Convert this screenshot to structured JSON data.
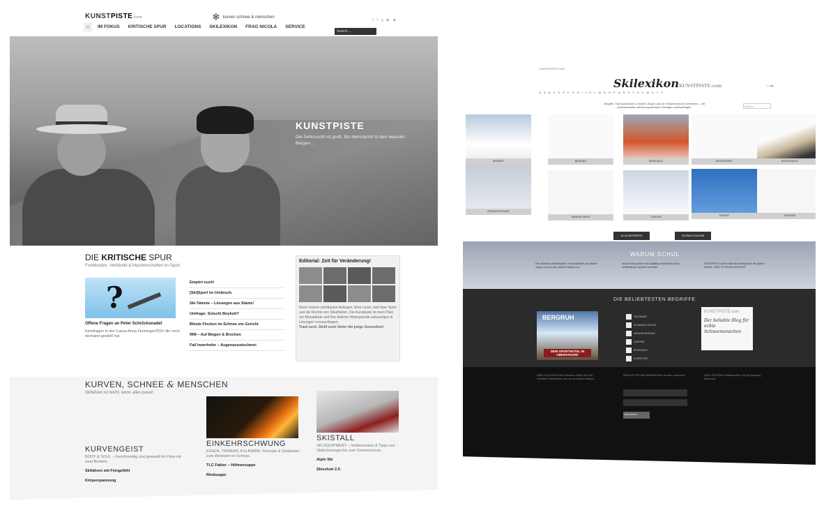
{
  "left": {
    "logo": {
      "main": "KUNST",
      "bold": "PISTE",
      "suffix": ".com"
    },
    "center_logo": "kurven schnee & menschen",
    "nav": [
      {
        "label": "⌂"
      },
      {
        "label": "IM FOKUS"
      },
      {
        "label": "KRITISCHE SPUR"
      },
      {
        "label": "LOCATIONS"
      },
      {
        "label": "SKILEXIKON"
      },
      {
        "label": "FRAG NICOLA"
      },
      {
        "label": "SERVICE"
      }
    ],
    "search_placeholder": "Search ...",
    "hero": {
      "title": "KUNSTPISTE",
      "subtitle": "Die Sehnsucht ist groß. Bis demnächst in den weissen Bergen ..."
    },
    "kritische": {
      "heading_pre": "DIE ",
      "heading_bold": "KRITISCHE",
      "heading_post": " SPUR",
      "sub": "Funktionäre, Verbände & Machenschaften im Sport",
      "caption": "Offene Fragen an Peter Schröcksnadel",
      "text": "Kernfragen in der Causa Anna Fenninger/ÖSV die noch niemand gestellt hat.",
      "list": [
        "Empört euch!",
        "[Ski]Sport im Umbruch.",
        "Ski-Talente – Lösungen aus Stams!",
        "Umfrage: Sotschi Boykott?",
        "Blinde Flecken im Schnee vor Gericht",
        "WM – Auf Biegen & Brechen",
        "Fall Innerhofer – Augenauswischerei"
      ]
    },
    "editorial": {
      "title": "Editorial: Zeit für Veränderung!",
      "text": "Einen meiner wichtigsten Anliegen, liebe Leser, sind faire Sport und die Rechte von Skiathleten. Die Kunstpiste ist mein Platz um Missstände und ihre tieferen Hintergründe aufzuzeigen & Lösungen vorzuschlagen.",
      "text2": "Traut euch. Stellt euch hinter die junge Generation!"
    },
    "kurven": {
      "title_a": "KURVEN, SCHNEE ",
      "title_amp": "&",
      "title_b": " MENSCHEN",
      "sub": "Skifahren ist leicht, wenn alles passt!",
      "cards": [
        {
          "title": "KURVENGEIST",
          "sub": "BODY & SOUL – Geschmeidig und gewandt im Flow mit zwei Brettern.",
          "links": [
            "Skifahren mit Feingefühl",
            "Körperspannung"
          ]
        },
        {
          "title": "EINKEHRSCHWUNG",
          "sub": "ESSEN, TRINKEN, KULINARIK. Rezepte & Gedanken zum Wohlsein im Schnee.",
          "links": [
            "TLC Faktor – Hühnersuppe",
            "Rindsuppe"
          ]
        },
        {
          "title": "SKISTALL",
          "sub": "SKI EQUIPMENT – Insiderwissen & Tipps von Skitechnologie bis zum Sonnenschutz.",
          "links": [
            "Alpin Ski",
            "Skischuh 2.0."
          ]
        }
      ]
    }
  },
  "right": {
    "topline": "KUNSTPISTE.COM",
    "logo": "Skilexikon",
    "logo_small": "KUNSTPISTE.com",
    "alphabet": [
      "#",
      "A",
      "B",
      "C",
      "D",
      "E",
      "F",
      "G",
      "H",
      "I",
      "J",
      "K",
      "L",
      "M",
      "N",
      "O",
      "P",
      "Q",
      "R",
      "S",
      "T",
      "U",
      "V",
      "W",
      "X",
      "Y",
      "Z"
    ],
    "desc": "Begriffe, Fachausdrücke & Insider-Jargon aus der Skiwelt kennen verstehen – mit professionellen deutschsprachigen Einträgen nachschlagen.",
    "search": "Search",
    "tiles": [
      "ABFAHRT",
      "BINDUNG",
      "BERGHAUS",
      "BOGENSTART",
      "BOGENKANTE",
      "SPRUNGSCHANZE",
      "BANDEN-SKIEN",
      "TORLAUF",
      "TRANSIT",
      "SCHANZE"
    ],
    "buttons": [
      "ALLE BEGRIFFE",
      "SCHNELLSUCHE"
    ],
    "warum": "WARUM SCHUL",
    "warum_cols": [
      "Das Skilexikon stellt Begriffe, Fachausdrücke und Insider-Jargon rund um den alpinen Skisport vor.",
      "Jeden Eintrag haben wir sorgfältig recherchiert und in verständlicher Sprache formuliert.",
      "KUNSTPISTE.COM erklärt die Hintergründe der alpinen Skiwelt – WAS IST EIN SKILEXIKON?"
    ],
    "popular_title": "DIE BELIEBTESTEN BEGRIFFE",
    "ad_title": "BERGRUH",
    "ad_banner": "DEIN SPORTHOTEL IN OBERSTDORF",
    "popular": [
      "TELEMARK",
      "SCHWUNG HOCHE",
      "ABFAHRTSHOCKE",
      "CARVING",
      "SKISCHULE",
      "SCHRIFTEN"
    ],
    "card_top": "KUNSTPISTE.com",
    "card_text": "Der beliebte Blog für echte Schneemenschen",
    "footer_cols": [
      "ÜBER SKILEXIKON  Das Skilexikon erklärt dem Ski-Liebhaber Fachbegriffe rund um den alpinen Skisport.",
      "NEWSLETTER ABONNIEREN  Bleib auf dem Laufenden!",
      "NEUE EINTRÄGE  Abfahrtsschuh, Carving Schwung, Skisprung"
    ],
    "footer_button": "Abonnieren"
  }
}
